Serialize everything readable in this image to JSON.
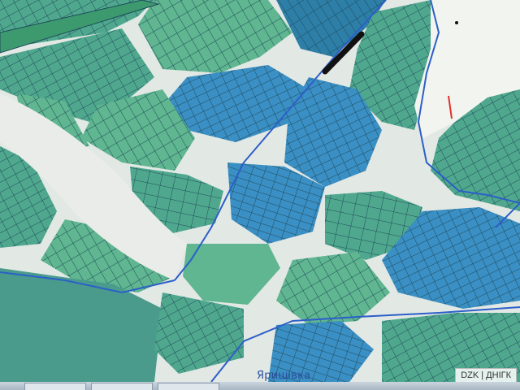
{
  "map": {
    "place_label": "Яришівка",
    "attribution": "DZK | ДНІГК"
  },
  "colors": {
    "parcel_teal": "#4fa88e",
    "parcel_green": "#5fb690",
    "parcel_blue": "#3a8fc4",
    "parcel_deep": "#2d7fa8",
    "parcel_outline": "#1f4a5a",
    "road_fill": "#e2e8e4",
    "road_line": "#2c5fc9",
    "meadow": "#f2f4ef",
    "marker_black": "#111111",
    "marker_red": "#e0302a"
  },
  "icons": {
    "top_left_parcel": "green-band",
    "tablet_taskbar": "taskbar"
  }
}
